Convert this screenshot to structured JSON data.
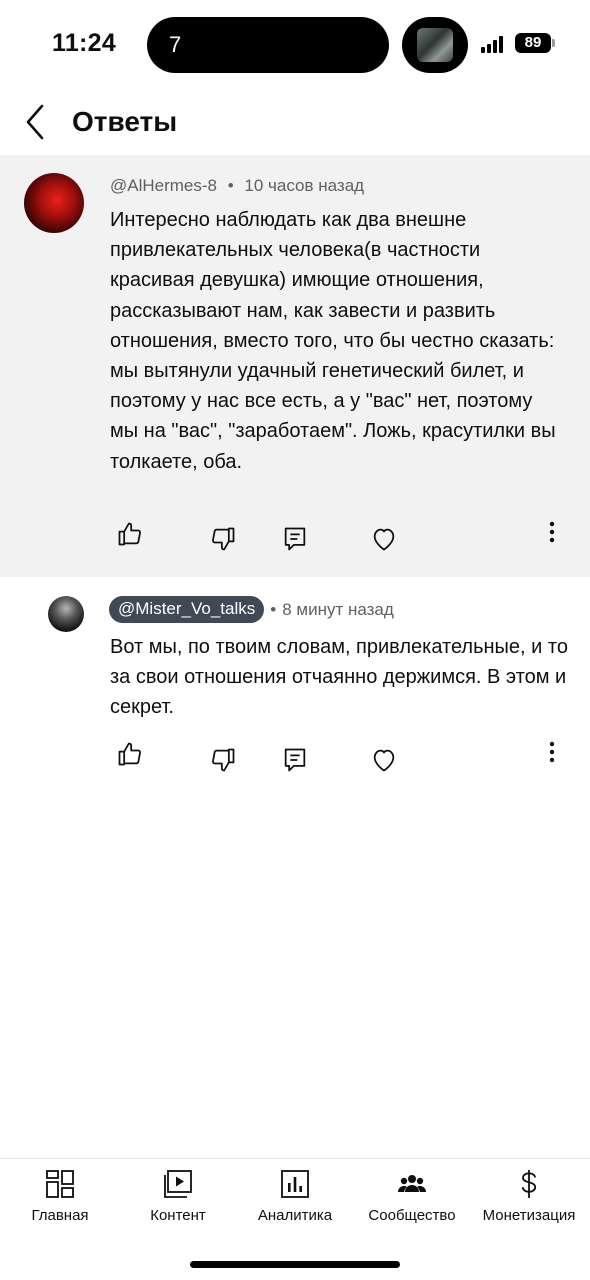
{
  "status_bar": {
    "time": "11:24",
    "island_text": "7",
    "battery": "89"
  },
  "header": {
    "title": "Ответы"
  },
  "comments": [
    {
      "author": "@AlHermes-8",
      "separator": "•",
      "time": "10 часов назад",
      "text": "Интересно наблюдать как два внешне привлекательных человека(в частности красивая девушка) имющие отношения, рассказывают нам, как завести и развить отношения, вместо того, что бы честно сказать: мы вытянули удачный генетический билет, и поэтому у нас все есть, а у \"вас\" нет, поэтому мы на \"вас\", \"заработаем\". Ложь, красутилки вы толкаете, оба."
    },
    {
      "author": "@Mister_Vo_talks",
      "separator": "•",
      "time": "8 минут назад",
      "text": "Вот мы, по твоим словам, привлекательные, и то за свои отношения отчаянно держимся. В этом и секрет."
    }
  ],
  "bottom_nav": [
    {
      "label": "Главная",
      "icon": "dashboard-icon"
    },
    {
      "label": "Контент",
      "icon": "content-icon"
    },
    {
      "label": "Аналитика",
      "icon": "analytics-icon"
    },
    {
      "label": "Сообщество",
      "icon": "community-icon"
    },
    {
      "label": "Монетизация",
      "icon": "dollar-icon"
    }
  ],
  "colors": {
    "parent_bg": "#f2f2f2",
    "author_chip": "#3f4a56",
    "meta_text": "#606060"
  }
}
